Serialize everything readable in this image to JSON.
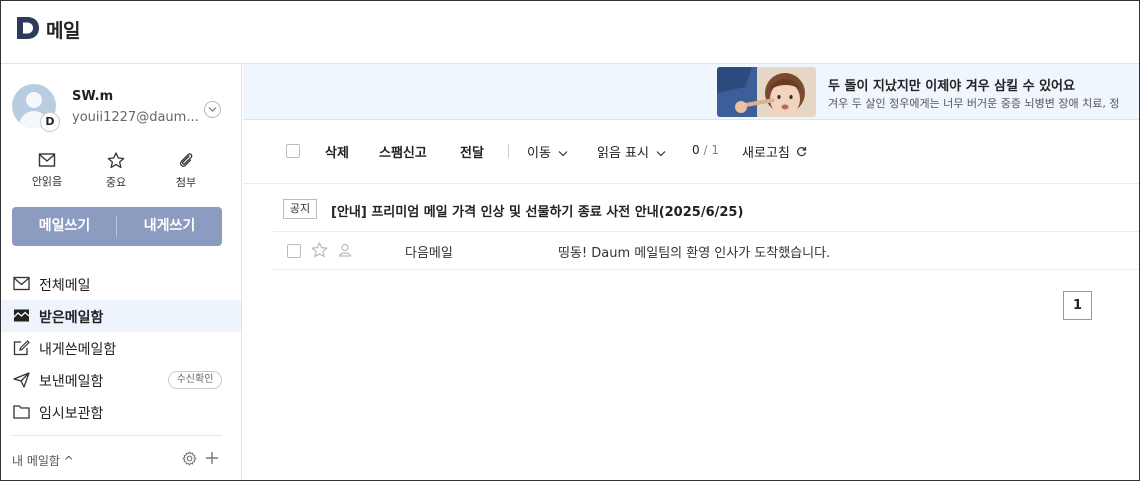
{
  "app": {
    "logo_letter": "D",
    "title": "메일"
  },
  "account": {
    "name": "SW.m",
    "email": "youii1227@daum....",
    "badge": "D"
  },
  "quick_filters": [
    {
      "label": "안읽음",
      "icon": "envelope-icon"
    },
    {
      "label": "중요",
      "icon": "star-icon"
    },
    {
      "label": "첨부",
      "icon": "paperclip-icon"
    }
  ],
  "compose": {
    "write_label": "메일쓰기",
    "self_label": "내게쓰기"
  },
  "folders": [
    {
      "label": "전체메일",
      "icon": "envelope-icon",
      "active": false
    },
    {
      "label": "받은메일함",
      "icon": "inbox-icon",
      "active": true
    },
    {
      "label": "내게쓴메일함",
      "icon": "self-note-icon",
      "active": false
    },
    {
      "label": "보낸메일함",
      "icon": "send-icon",
      "active": false,
      "badge": "수신확인"
    },
    {
      "label": "임시보관함",
      "icon": "folder-icon",
      "active": false
    }
  ],
  "my_mailbox": {
    "label": "내 메일함 ^"
  },
  "banner": {
    "title": "두 돌이 지났지만 이제야 겨우 삼킬 수 있어요",
    "subtitle": "겨우 두 살인 정우에게는 너무 버거운 중증 뇌병변 장애 치료, 정"
  },
  "toolbar": {
    "delete": "삭제",
    "spam": "스팸신고",
    "forward": "전달",
    "move": "이동",
    "read_mark": "읽음 표시",
    "count_selected": "0",
    "count_total": "/ 1",
    "refresh": "새로고침"
  },
  "notice": {
    "tag": "공지",
    "text": "[안내] 프리미엄 메일 가격 인상 및 선물하기 종료 사전 안내(2025/6/25)"
  },
  "mails": [
    {
      "sender": "다음메일",
      "subject": "띵동! Daum 메일팀의 환영 인사가 도착했습니다."
    }
  ],
  "pagination": {
    "current": "1"
  },
  "colors": {
    "accent": "#8b9cc0",
    "banner_bg": "#f0f6fd",
    "active_folder_bg": "#eef4fb"
  }
}
